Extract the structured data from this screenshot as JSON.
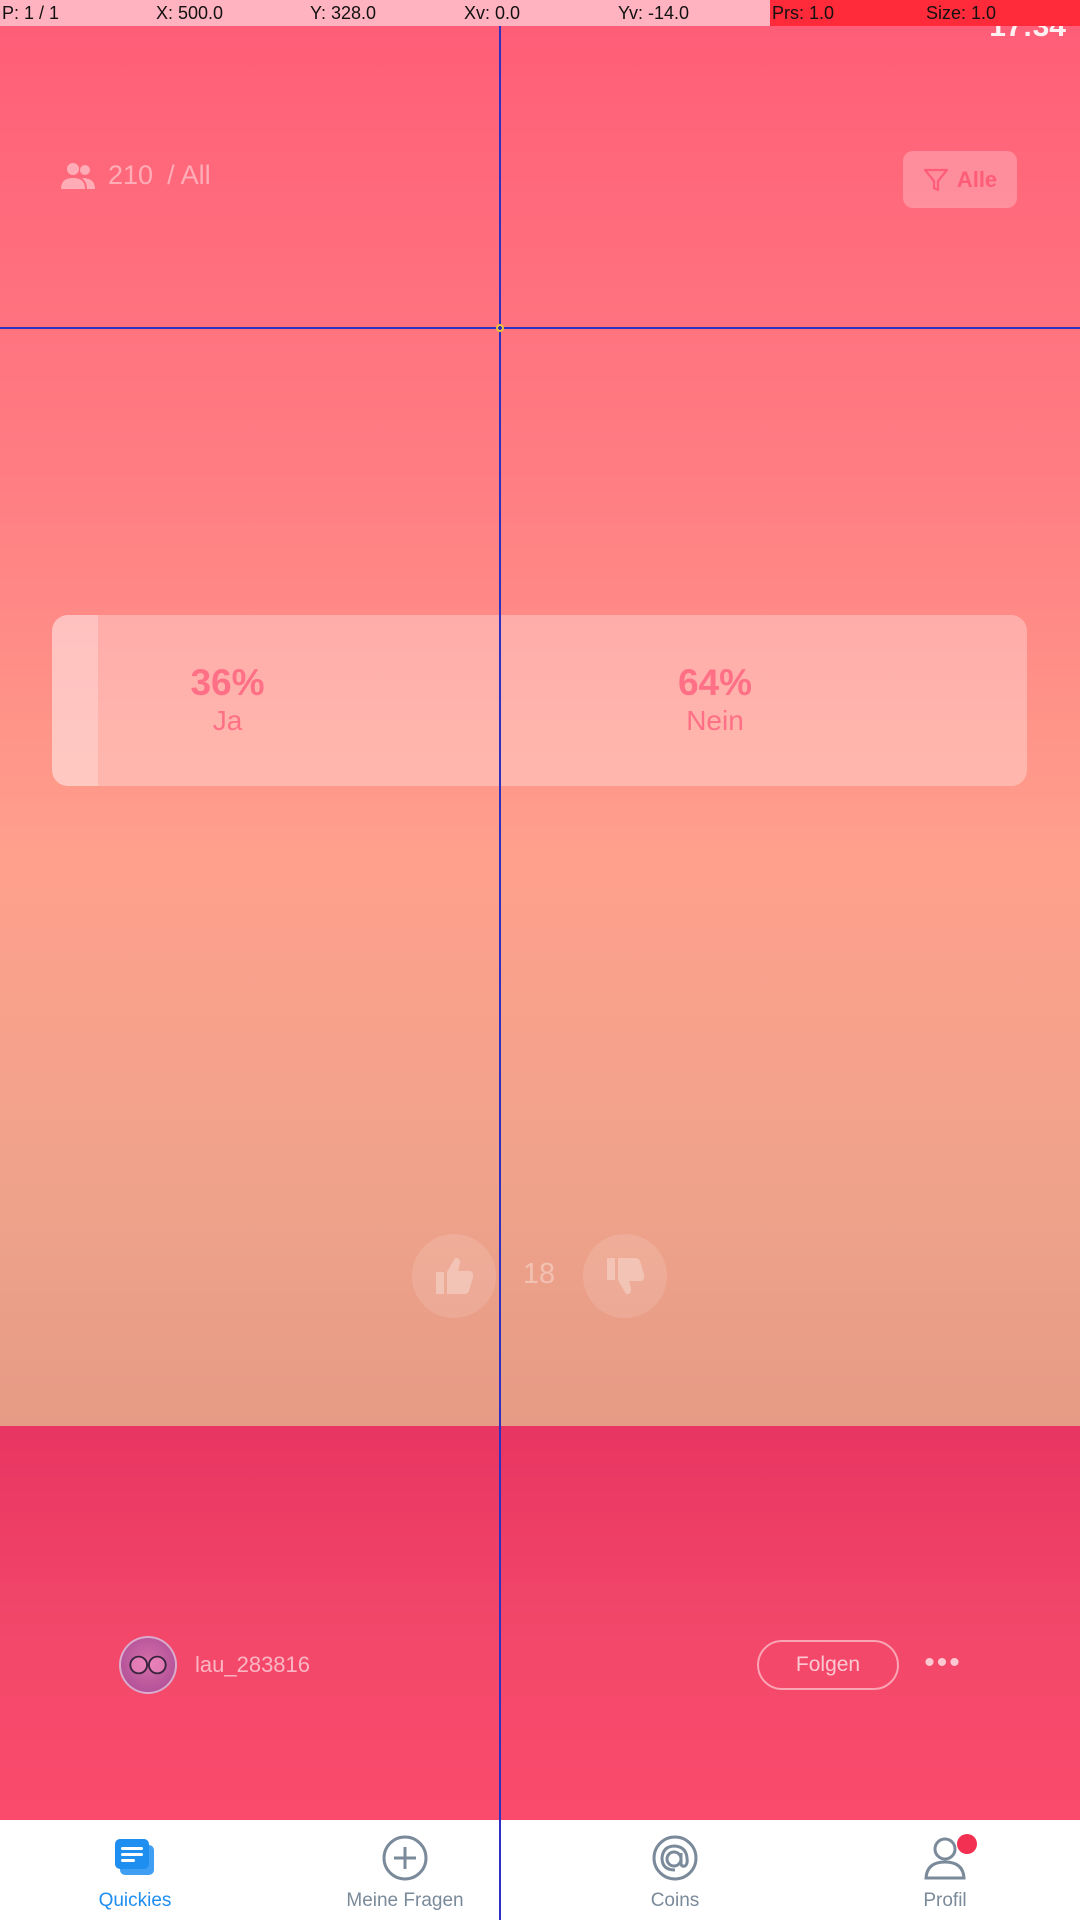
{
  "debug_bar": [
    {
      "text": "P: 1 / 1"
    },
    {
      "text": "X: 500.0"
    },
    {
      "text": "Y: 328.0"
    },
    {
      "text": "Xv: 0.0"
    },
    {
      "text": "Yv: -14.0"
    },
    {
      "text": "Prs: 1.0"
    },
    {
      "text": "Size: 1.0"
    }
  ],
  "status": {
    "clock": "17:34"
  },
  "audience": {
    "count": "210",
    "scope": "/ All",
    "icon": "people-icon"
  },
  "filter": {
    "label": "Alle",
    "icon": "filter-icon"
  },
  "poll": {
    "options": [
      {
        "percent": "36%",
        "label": "Ja",
        "share": 0.36
      },
      {
        "percent": "64%",
        "label": "Nein",
        "share": 0.64
      }
    ]
  },
  "votes": {
    "count": "18",
    "up_icon": "thumbs-up-icon",
    "down_icon": "thumbs-down-icon"
  },
  "author": {
    "username": "lau_283816",
    "follow_label": "Folgen",
    "more_label": "•••"
  },
  "nav": {
    "items": [
      {
        "label": "Quickies",
        "icon": "quickies-icon",
        "active": true
      },
      {
        "label": "Meine Fragen",
        "icon": "add-circle-icon"
      },
      {
        "label": "Coins",
        "icon": "at-coin-icon"
      },
      {
        "label": "Profil",
        "icon": "profile-icon",
        "badge": true
      }
    ]
  },
  "colors": {
    "accent": "#1f8ef1",
    "brand": "#ff5c77",
    "badge": "#f33052"
  }
}
